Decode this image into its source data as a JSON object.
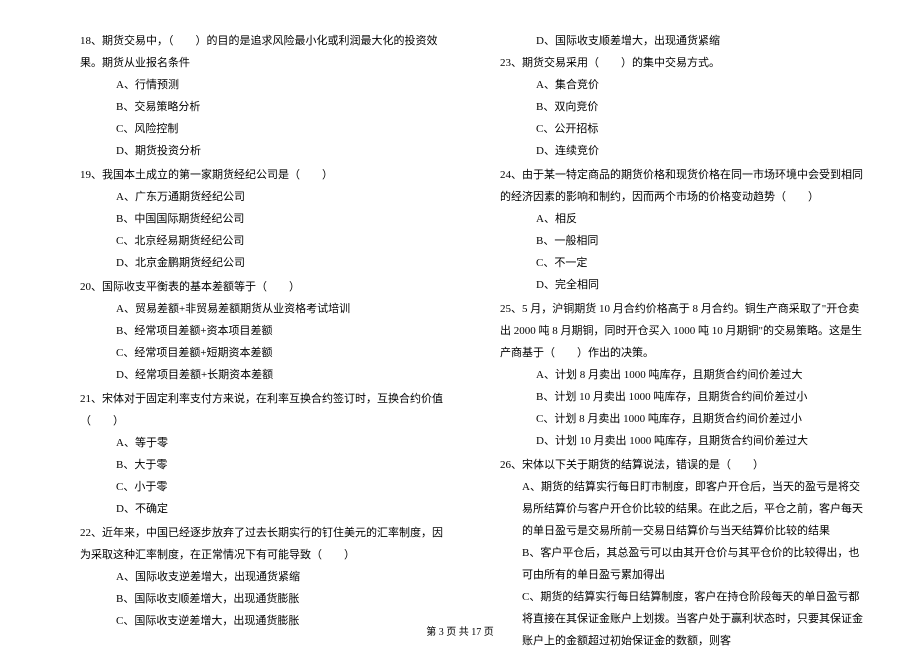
{
  "left": {
    "q18": {
      "text": "18、期货交易中，（　　）的目的是追求风险最小化或利润最大化的投资效果。期货从业报名条件",
      "opts": [
        "A、行情预测",
        "B、交易策略分析",
        "C、风险控制",
        "D、期货投资分析"
      ]
    },
    "q19": {
      "text": "19、我国本土成立的第一家期货经纪公司是（　　）",
      "opts": [
        "A、广东万通期货经纪公司",
        "B、中国国际期货经纪公司",
        "C、北京经易期货经纪公司",
        "D、北京金鹏期货经纪公司"
      ]
    },
    "q20": {
      "text": "20、国际收支平衡表的基本差额等于（　　）",
      "opts": [
        "A、贸易差额+非贸易差额期货从业资格考试培训",
        "B、经常项目差额+资本项目差额",
        "C、经常项目差额+短期资本差额",
        "D、经常项目差额+长期资本差额"
      ]
    },
    "q21": {
      "text": "21、宋体对于固定利率支付方来说，在利率互换合约签订时，互换合约价值（　　）",
      "opts": [
        "A、等于零",
        "B、大于零",
        "C、小于零",
        "D、不确定"
      ]
    },
    "q22": {
      "text": "22、近年来，中国已经逐步放弃了过去长期实行的钉住美元的汇率制度，因为采取这种汇率制度，在正常情况下有可能导致（　　）",
      "opts": [
        "A、国际收支逆差增大，出现通货紧缩",
        "B、国际收支顺差增大，出现通货膨胀",
        "C、国际收支逆差增大，出现通货膨胀"
      ]
    }
  },
  "right": {
    "q22d": "D、国际收支顺差增大，出现通货紧缩",
    "q23": {
      "text": "23、期货交易采用（　　）的集中交易方式。",
      "opts": [
        "A、集合竞价",
        "B、双向竞价",
        "C、公开招标",
        "D、连续竞价"
      ]
    },
    "q24": {
      "text": "24、由于某一特定商品的期货价格和现货价格在同一市场环境中会受到相同的经济因素的影响和制约，因而两个市场的价格变动趋势（　　）",
      "opts": [
        "A、相反",
        "B、一般相同",
        "C、不一定",
        "D、完全相同"
      ]
    },
    "q25": {
      "text1": "25、5 月，沪铜期货 10 月合约价格高于 8 月合约。铜生产商采取了\"开仓卖出 2000 吨 8 月期铜，同时开仓买入 1000 吨 10 月期铜\"的交易策略。这是生产商基于（　　）作出的决策。",
      "opts": [
        "A、计划 8 月卖出 1000 吨库存，且期货合约间价差过大",
        "B、计划 10 月卖出 1000 吨库存，且期货合约间价差过小",
        "C、计划 8 月卖出 1000 吨库存，且期货合约间价差过小",
        "D、计划 10 月卖出 1000 吨库存，且期货合约间价差过大"
      ]
    },
    "q26": {
      "text": "26、宋体以下关于期货的结算说法，错误的是（　　）",
      "optA": "A、期货的结算实行每日盯市制度，即客户开仓后，当天的盈亏是将交易所结算价与客户开仓价比较的结果。在此之后，平仓之前，客户每天的单日盈亏是交易所前一交易日结算价与当天结算价比较的结果",
      "optB": "B、客户平仓后，其总盈亏可以由其开仓价与其平仓价的比较得出，也可由所有的单日盈亏累加得出",
      "optC": "C、期货的结算实行每日结算制度，客户在持仓阶段每天的单日盈亏都将直接在其保证金账户上划拨。当客户处于赢利状态时，只要其保证金账户上的金额超过初始保证金的数额，则客"
    }
  },
  "footer": "第 3 页 共 17 页"
}
